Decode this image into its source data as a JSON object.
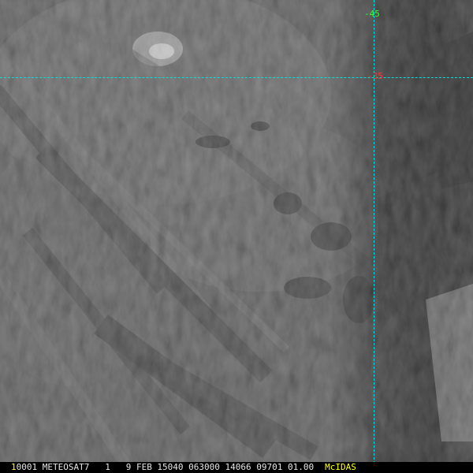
{
  "overlay": {
    "lat_label": "-45",
    "lon_label": "-35",
    "grid_color": "#00e0e0",
    "lat_label_color": "#33ff33",
    "lon_label_color": "#ff3333"
  },
  "status_bar": {
    "frame_number": "1",
    "fields": "0001 METEOSAT7   1   9 FEB 15040 063000 14066 09701 01.00",
    "brand": "McIDAS",
    "highlight_color": "#ffff33",
    "text_color": "#e6e6e6"
  },
  "image": {
    "satellite": "METEOSAT7",
    "palette": [
      "#1a1a1a",
      "#2b2b2b",
      "#3a3a3a",
      "#4a4a4a",
      "#5c5c5c",
      "#737373",
      "#8f8f8f",
      "#b5b5b5"
    ]
  }
}
